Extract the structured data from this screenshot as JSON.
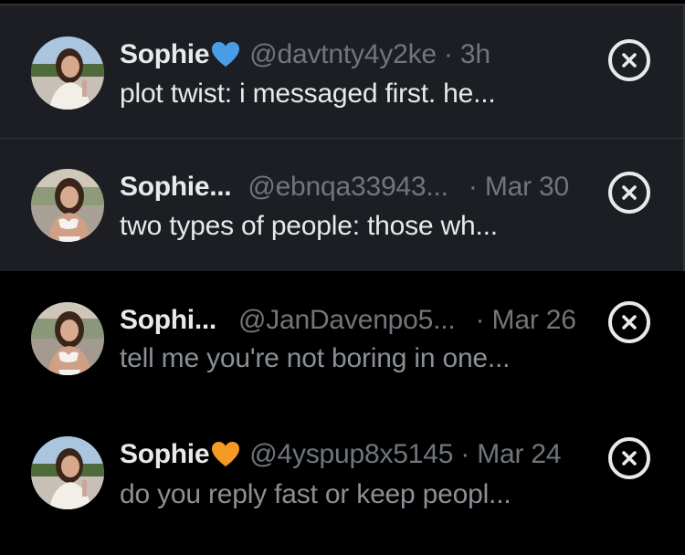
{
  "accent": {
    "verified_blue": "#4a9de8",
    "verified_gold": "#f59a24"
  },
  "conversations": [
    {
      "name": "Sophie",
      "badge_icon": "blue-heart-icon",
      "handle": "@davtnty4y2ke",
      "separator": "·",
      "time": "3h",
      "preview": "plot twist: i messaged first. he...",
      "state": "unread"
    },
    {
      "name": "Sophie...",
      "badge_icon": "",
      "handle": "@ebnqa33943...",
      "separator": "·",
      "time": "Mar 30",
      "preview": "two types of people: those wh...",
      "state": "unread"
    },
    {
      "name": "Sophi...",
      "badge_icon": "",
      "handle": "@JanDavenpo5...",
      "separator": "·",
      "time": "Mar 26",
      "preview": "tell me you're not boring in one...",
      "state": "read"
    },
    {
      "name": "Sophie",
      "badge_icon": "orange-heart-icon",
      "handle": "@4yspup8x5145",
      "separator": "·",
      "time": "Mar 24",
      "preview": "do you reply fast or keep peopl...",
      "state": "read"
    }
  ],
  "actions": {
    "dismiss_icon": "close-circle-icon"
  }
}
